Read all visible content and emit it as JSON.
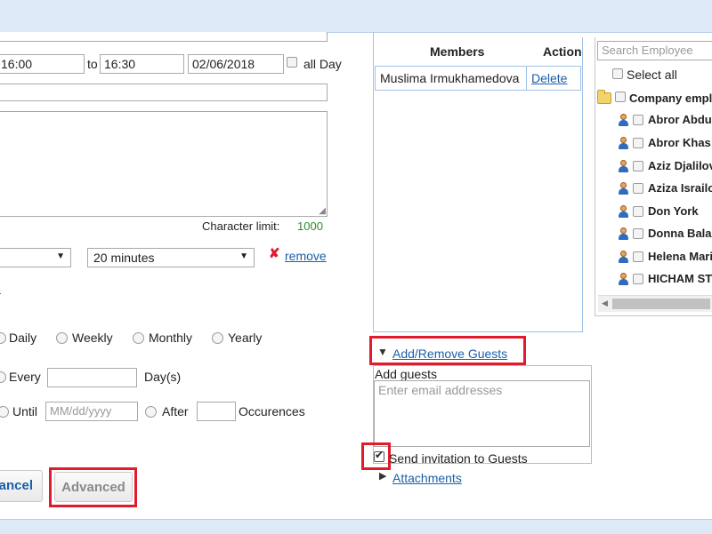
{
  "event": {
    "start_time": "16:00",
    "to_label": "to",
    "end_time": "16:30",
    "date": "02/06/2018",
    "all_day_label": "all Day",
    "character_limit_label": "Character limit:",
    "character_limit_value": "1000"
  },
  "reminder": {
    "minutes_value": "20 minutes",
    "remove_label": "remove"
  },
  "recurrence": {
    "options": [
      "Daily",
      "Weekly",
      "Monthly",
      "Yearly"
    ],
    "every_label": "Every",
    "days_label": "Day(s)",
    "until_label": "Until",
    "until_placeholder": "MM/dd/yyyy",
    "after_label": "After",
    "occurrences_label": "Occurences"
  },
  "buttons": {
    "cancel_label": "ancel",
    "advanced_label": "Advanced"
  },
  "members": {
    "col_members": "Members",
    "col_action": "Action",
    "rows": [
      {
        "name": "Muslima Irmukhamedova",
        "action": "Delete"
      }
    ]
  },
  "guests": {
    "toggle_label": "Add/Remove Guests",
    "add_guests_label": "Add guests",
    "email_placeholder": "Enter email addresses",
    "send_invitation_label": "Send invitation to Guests",
    "attachments_label": "Attachments"
  },
  "employees": {
    "search_placeholder": "Search Employee",
    "select_all_label": "Select all",
    "group_label": "Company empl",
    "list": [
      "Abror Abdu",
      "Abror Khas",
      "Aziz Djalilov",
      "Aziza Israilo",
      "Don York",
      "Donna Bala",
      "Helena Mari",
      "HICHAM ST"
    ]
  },
  "colors": {
    "highlight": "#e01b2b",
    "link": "#1a5fa8",
    "character_limit_value": "#2e8b2e"
  }
}
